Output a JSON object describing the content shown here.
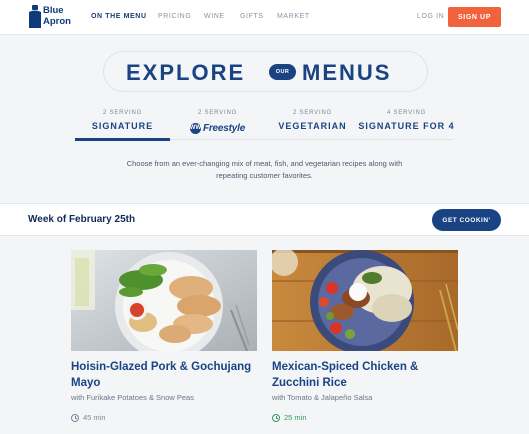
{
  "header": {
    "logo_line1": "Blue",
    "logo_line2": "Apron",
    "nav": [
      "ON THE MENU",
      "PRICING",
      "WINE",
      "GIFTS",
      "MARKET"
    ],
    "login": "LOG IN",
    "signup": "SIGN UP"
  },
  "hero": {
    "word1": "EXPLORE",
    "badge": "OUR",
    "word2": "MENUS"
  },
  "tabs": [
    {
      "small": "2 SERVING",
      "label": "SIGNATURE"
    },
    {
      "small": "2 SERVING",
      "label": "Freestyle",
      "icon": "WW"
    },
    {
      "small": "2 SERVING",
      "label": "VEGETARIAN"
    },
    {
      "small": "4 SERVING",
      "label": "SIGNATURE FOR 4"
    }
  ],
  "intro": "Choose from an ever-changing mix of meat, fish, and vegetarian recipes along with repeating customer favorites.",
  "week": {
    "label": "Week of February 25th",
    "cta": "GET COOKIN'"
  },
  "cards": [
    {
      "title": "Hoisin-Glazed Pork & Gochujang Mayo",
      "subtitle": "with Furikake Potatoes & Snow Peas",
      "time": "45 min"
    },
    {
      "title": "Mexican-Spiced Chicken & Zucchini Rice",
      "subtitle": "with Tomato & Jalapeño Salsa",
      "time": "25 min"
    }
  ],
  "colors": {
    "brand": "#1a4384",
    "accent": "#f0633c",
    "time_green": "#2e9b63",
    "time_gray": "#7c8799"
  }
}
